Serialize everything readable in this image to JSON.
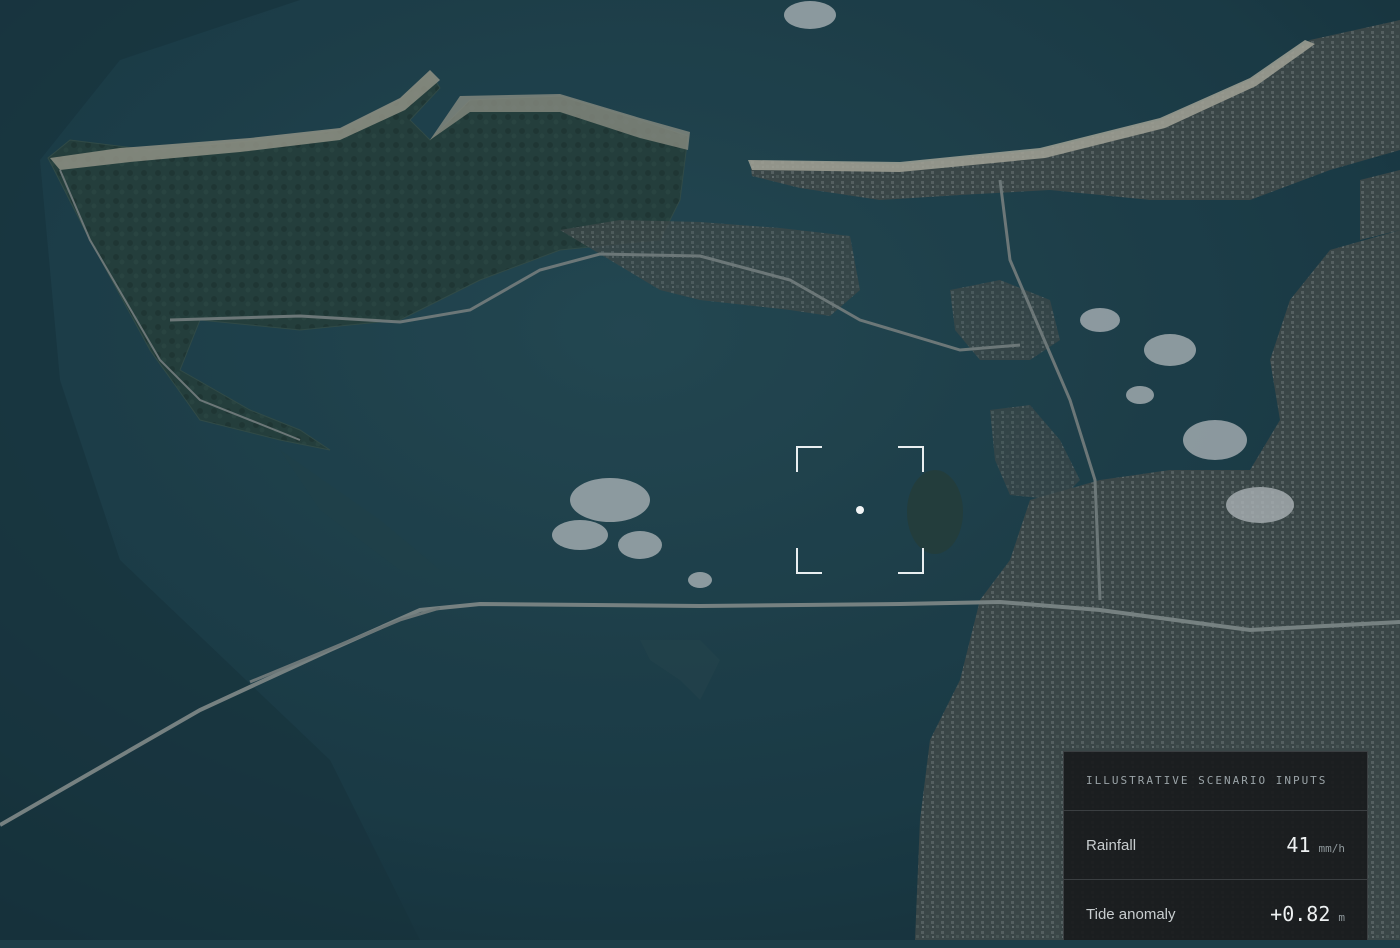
{
  "panel": {
    "title": "ILLUSTRATIVE SCENARIO INPUTS",
    "rows": [
      {
        "label": "Rainfall",
        "value": "41",
        "unit": "mm/h"
      },
      {
        "label": "Tide anomaly",
        "value": "+0.82",
        "unit": "m"
      }
    ]
  },
  "colors": {
    "water": "#1d3e48",
    "land": "#2a433f",
    "beach": "#c9c6b3",
    "urban": "#55605f",
    "road": "#8c9694",
    "cloud": "#e8ecee",
    "panel_bg": "#181a1c"
  },
  "icons": [
    "target-reticle-icon",
    "location-dot-icon"
  ]
}
